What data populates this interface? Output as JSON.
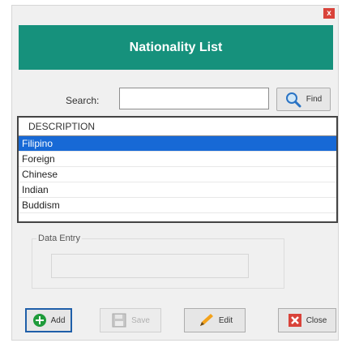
{
  "dialog": {
    "title": "Nationality List",
    "close_glyph": "x"
  },
  "search": {
    "label": "Search:",
    "value": "",
    "find_label": "Find"
  },
  "list": {
    "header": "DESCRIPTION",
    "items": [
      {
        "label": "Filipino",
        "selected": true
      },
      {
        "label": "Foreign",
        "selected": false
      },
      {
        "label": "Chinese",
        "selected": false
      },
      {
        "label": "Indian",
        "selected": false
      },
      {
        "label": "Buddism",
        "selected": false
      }
    ]
  },
  "data_entry": {
    "legend": "Data Entry",
    "value": ""
  },
  "buttons": {
    "add": "Add",
    "save": "Save",
    "edit": "Edit",
    "close": "Close"
  },
  "colors": {
    "banner": "#16917c",
    "selection": "#1769d6",
    "close_red": "#d9433a"
  },
  "icons": [
    "close-icon",
    "search-icon",
    "add-icon",
    "save-icon",
    "edit-icon",
    "close-icon"
  ]
}
